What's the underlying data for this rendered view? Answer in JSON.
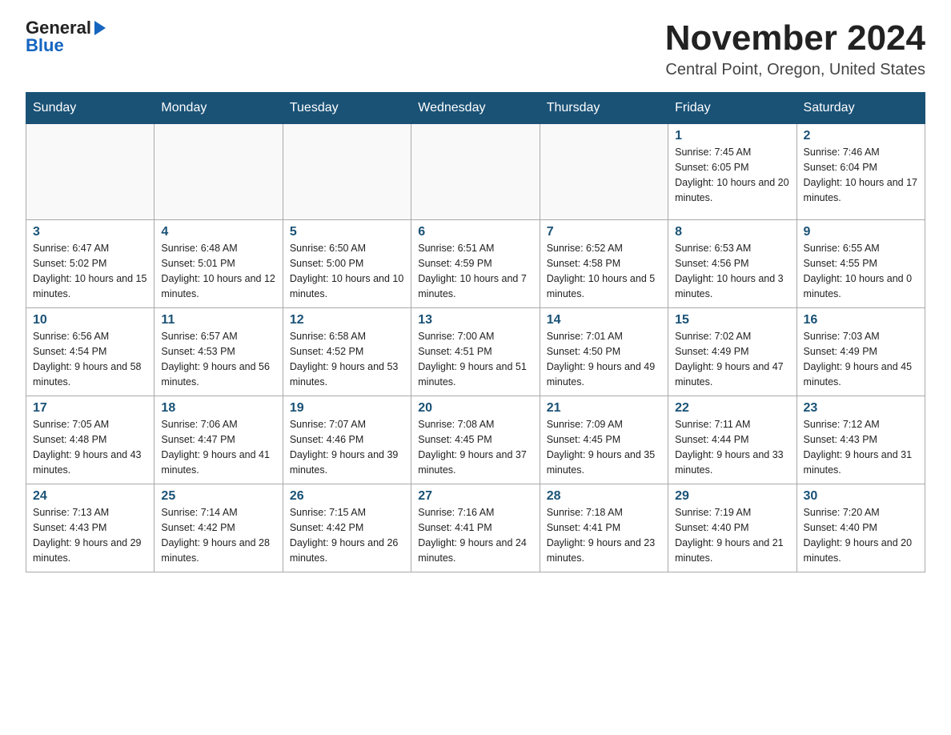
{
  "header": {
    "logo_general": "General",
    "logo_blue": "Blue",
    "month_title": "November 2024",
    "location": "Central Point, Oregon, United States"
  },
  "weekdays": [
    "Sunday",
    "Monday",
    "Tuesday",
    "Wednesday",
    "Thursday",
    "Friday",
    "Saturday"
  ],
  "weeks": [
    [
      {
        "day": "",
        "info": ""
      },
      {
        "day": "",
        "info": ""
      },
      {
        "day": "",
        "info": ""
      },
      {
        "day": "",
        "info": ""
      },
      {
        "day": "",
        "info": ""
      },
      {
        "day": "1",
        "info": "Sunrise: 7:45 AM\nSunset: 6:05 PM\nDaylight: 10 hours and 20 minutes."
      },
      {
        "day": "2",
        "info": "Sunrise: 7:46 AM\nSunset: 6:04 PM\nDaylight: 10 hours and 17 minutes."
      }
    ],
    [
      {
        "day": "3",
        "info": "Sunrise: 6:47 AM\nSunset: 5:02 PM\nDaylight: 10 hours and 15 minutes."
      },
      {
        "day": "4",
        "info": "Sunrise: 6:48 AM\nSunset: 5:01 PM\nDaylight: 10 hours and 12 minutes."
      },
      {
        "day": "5",
        "info": "Sunrise: 6:50 AM\nSunset: 5:00 PM\nDaylight: 10 hours and 10 minutes."
      },
      {
        "day": "6",
        "info": "Sunrise: 6:51 AM\nSunset: 4:59 PM\nDaylight: 10 hours and 7 minutes."
      },
      {
        "day": "7",
        "info": "Sunrise: 6:52 AM\nSunset: 4:58 PM\nDaylight: 10 hours and 5 minutes."
      },
      {
        "day": "8",
        "info": "Sunrise: 6:53 AM\nSunset: 4:56 PM\nDaylight: 10 hours and 3 minutes."
      },
      {
        "day": "9",
        "info": "Sunrise: 6:55 AM\nSunset: 4:55 PM\nDaylight: 10 hours and 0 minutes."
      }
    ],
    [
      {
        "day": "10",
        "info": "Sunrise: 6:56 AM\nSunset: 4:54 PM\nDaylight: 9 hours and 58 minutes."
      },
      {
        "day": "11",
        "info": "Sunrise: 6:57 AM\nSunset: 4:53 PM\nDaylight: 9 hours and 56 minutes."
      },
      {
        "day": "12",
        "info": "Sunrise: 6:58 AM\nSunset: 4:52 PM\nDaylight: 9 hours and 53 minutes."
      },
      {
        "day": "13",
        "info": "Sunrise: 7:00 AM\nSunset: 4:51 PM\nDaylight: 9 hours and 51 minutes."
      },
      {
        "day": "14",
        "info": "Sunrise: 7:01 AM\nSunset: 4:50 PM\nDaylight: 9 hours and 49 minutes."
      },
      {
        "day": "15",
        "info": "Sunrise: 7:02 AM\nSunset: 4:49 PM\nDaylight: 9 hours and 47 minutes."
      },
      {
        "day": "16",
        "info": "Sunrise: 7:03 AM\nSunset: 4:49 PM\nDaylight: 9 hours and 45 minutes."
      }
    ],
    [
      {
        "day": "17",
        "info": "Sunrise: 7:05 AM\nSunset: 4:48 PM\nDaylight: 9 hours and 43 minutes."
      },
      {
        "day": "18",
        "info": "Sunrise: 7:06 AM\nSunset: 4:47 PM\nDaylight: 9 hours and 41 minutes."
      },
      {
        "day": "19",
        "info": "Sunrise: 7:07 AM\nSunset: 4:46 PM\nDaylight: 9 hours and 39 minutes."
      },
      {
        "day": "20",
        "info": "Sunrise: 7:08 AM\nSunset: 4:45 PM\nDaylight: 9 hours and 37 minutes."
      },
      {
        "day": "21",
        "info": "Sunrise: 7:09 AM\nSunset: 4:45 PM\nDaylight: 9 hours and 35 minutes."
      },
      {
        "day": "22",
        "info": "Sunrise: 7:11 AM\nSunset: 4:44 PM\nDaylight: 9 hours and 33 minutes."
      },
      {
        "day": "23",
        "info": "Sunrise: 7:12 AM\nSunset: 4:43 PM\nDaylight: 9 hours and 31 minutes."
      }
    ],
    [
      {
        "day": "24",
        "info": "Sunrise: 7:13 AM\nSunset: 4:43 PM\nDaylight: 9 hours and 29 minutes."
      },
      {
        "day": "25",
        "info": "Sunrise: 7:14 AM\nSunset: 4:42 PM\nDaylight: 9 hours and 28 minutes."
      },
      {
        "day": "26",
        "info": "Sunrise: 7:15 AM\nSunset: 4:42 PM\nDaylight: 9 hours and 26 minutes."
      },
      {
        "day": "27",
        "info": "Sunrise: 7:16 AM\nSunset: 4:41 PM\nDaylight: 9 hours and 24 minutes."
      },
      {
        "day": "28",
        "info": "Sunrise: 7:18 AM\nSunset: 4:41 PM\nDaylight: 9 hours and 23 minutes."
      },
      {
        "day": "29",
        "info": "Sunrise: 7:19 AM\nSunset: 4:40 PM\nDaylight: 9 hours and 21 minutes."
      },
      {
        "day": "30",
        "info": "Sunrise: 7:20 AM\nSunset: 4:40 PM\nDaylight: 9 hours and 20 minutes."
      }
    ]
  ]
}
